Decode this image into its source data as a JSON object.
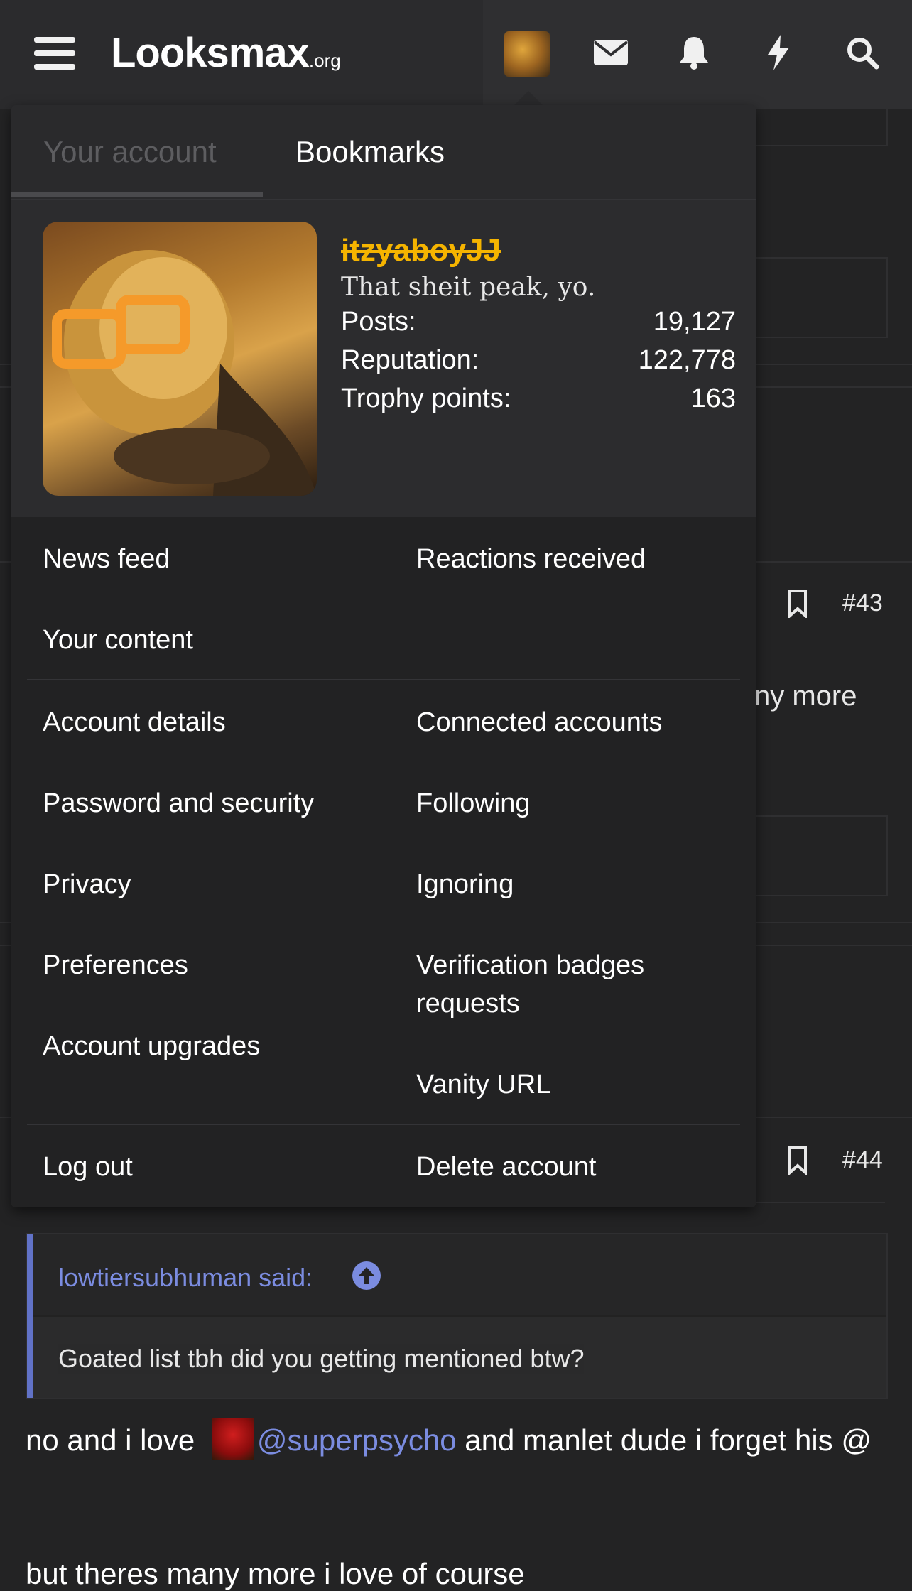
{
  "header": {
    "logo_text": "Looksmax",
    "logo_suffix": ".org",
    "icons": [
      "menu-icon",
      "envelope-icon",
      "bell-icon",
      "bolt-icon",
      "search-icon"
    ]
  },
  "dropdown": {
    "tabs": [
      "Your account",
      "Bookmarks"
    ],
    "profile": {
      "username": "itzyaboyJJ",
      "tagline": "That sheit peak, yo.",
      "stats": [
        {
          "label": "Posts:",
          "value": "19,127"
        },
        {
          "label": "Reputation:",
          "value": "122,778"
        },
        {
          "label": "Trophy points:",
          "value": "163"
        }
      ]
    },
    "menu": {
      "news_feed": "News feed",
      "reactions_received": "Reactions received",
      "your_content": "Your content",
      "account_details": "Account details",
      "connected_accounts": "Connected accounts",
      "password_security": "Password and security",
      "following": "Following",
      "privacy": "Privacy",
      "ignoring": "Ignoring",
      "preferences": "Preferences",
      "verification_badges": "Verification badges requests",
      "account_upgrades": "Account upgrades",
      "vanity_url": "Vanity URL",
      "log_out": "Log out",
      "delete_account": "Delete account"
    }
  },
  "background": {
    "post_43": "#43",
    "post_44": "#44",
    "partial_text": "ny more"
  },
  "quote": {
    "author": "lowtiersubhuman said:",
    "body": "Goated list tbh did you getting mentioned btw?"
  },
  "reply": {
    "part1": "no and i love ",
    "mention": "@superpsycho",
    "part2": " and manlet dude i forget his @",
    "line2": "but theres many more i love of course"
  },
  "colors": {
    "accent": "#7b8ce0",
    "username": "#f5b400",
    "background": "#232324"
  }
}
